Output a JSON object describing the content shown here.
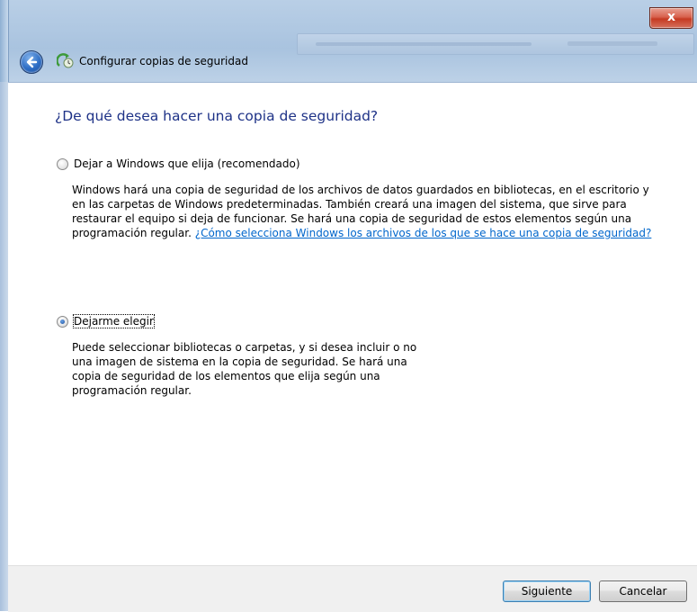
{
  "window": {
    "title": "Configurar copias de seguridad",
    "close_glyph": "x",
    "icons": {
      "back": "back-arrow-icon",
      "app": "backup-icon"
    }
  },
  "main": {
    "heading": "¿De qué desea hacer una copia de seguridad?",
    "options": [
      {
        "label": "Dejar a Windows que elija (recomendado)",
        "selected": false,
        "description": "Windows hará una copia de seguridad de los archivos de datos guardados en bibliotecas, en el escritorio y en las carpetas de Windows predeterminadas. También creará una imagen del sistema, que sirve para restaurar el equipo si deja de funcionar. Se hará una copia de seguridad de estos elementos según una programación regular.",
        "link": "¿Cómo selecciona Windows los archivos de los que se hace una copia de seguridad?"
      },
      {
        "label": "Dejarme elegir",
        "selected": true,
        "description": "Puede seleccionar bibliotecas o carpetas, y si desea incluir o no una imagen de sistema en la copia de seguridad. Se hará una copia de seguridad de los elementos que elija según una programación regular."
      }
    ]
  },
  "footer": {
    "next_label": "Siguiente",
    "cancel_label": "Cancelar"
  },
  "colors": {
    "heading": "#1e3287",
    "link": "#0066cc",
    "close_button": "#c53a22"
  }
}
